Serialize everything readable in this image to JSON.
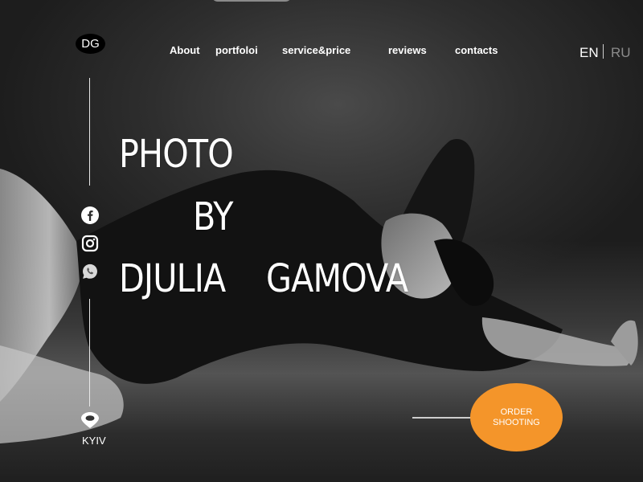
{
  "logo": {
    "text": "DG"
  },
  "nav": {
    "items": [
      {
        "label": "About"
      },
      {
        "label": "portfoloi"
      },
      {
        "label": "service&price"
      },
      {
        "label": "reviews"
      },
      {
        "label": "contacts"
      }
    ]
  },
  "language": {
    "active": "EN",
    "inactive": "RU"
  },
  "social": {
    "icons": [
      "facebook-icon",
      "instagram-icon",
      "whatsapp-icon"
    ]
  },
  "hero": {
    "line1": "PHOTO",
    "line2": "BY",
    "line3_first": "DJULIA",
    "line3_last": "GAMOVA"
  },
  "location": {
    "icon": "location-pin-icon",
    "city": "KYIV"
  },
  "cta": {
    "line1": "ORDER",
    "line2": "SHOOTING"
  },
  "colors": {
    "accent": "#f4952a",
    "inactive_lang": "#8c8c8c"
  }
}
